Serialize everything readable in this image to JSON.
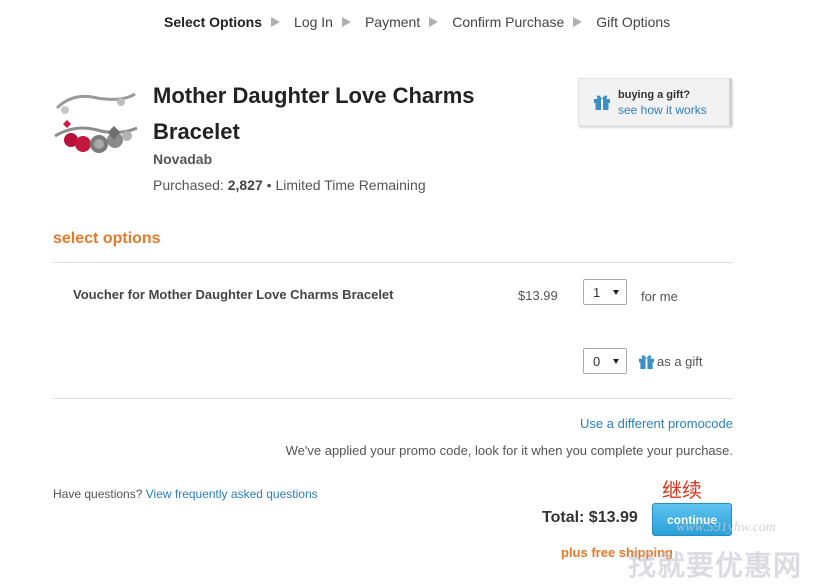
{
  "breadcrumb": {
    "steps": [
      "Select Options",
      "Log In",
      "Payment",
      "Confirm Purchase",
      "Gift Options"
    ],
    "active_index": 0
  },
  "product": {
    "title": "Mother Daughter Love Charms Bracelet",
    "brand": "Novadab",
    "purchased_label": "Purchased:",
    "purchased_count": "2,827",
    "purchased_suffix": "• Limited Time Remaining",
    "thumbnail_icon": "charm-bracelet-image"
  },
  "gift_badge": {
    "line1": "buying a gift?",
    "line2": "see how it works",
    "icon": "gift-icon"
  },
  "options": {
    "heading": "select options",
    "item_name": "Voucher for Mother Daughter Love Charms Bracelet",
    "price": "$13.99",
    "qty_for_me": "1",
    "for_me_label": "for me",
    "qty_gift": "0",
    "gift_label": "as a gift"
  },
  "promo": {
    "link": "Use a different promocode",
    "message": "We've applied your promo code, look for it when you complete your purchase."
  },
  "footer": {
    "questions_prefix": "Have questions?",
    "questions_link": "View frequently asked questions",
    "total": "Total: $13.99",
    "continue_label": "continue",
    "continue_annotation": "继续",
    "free_shipping": "plus free shipping"
  },
  "watermark": {
    "url": "www.591yhw.com",
    "text": "找就要优惠网"
  },
  "colors": {
    "accent_orange": "#e8782a",
    "link_blue": "#2a7fc0",
    "button_blue": "#2aa0d8",
    "annotation_red": "#e0321a"
  }
}
